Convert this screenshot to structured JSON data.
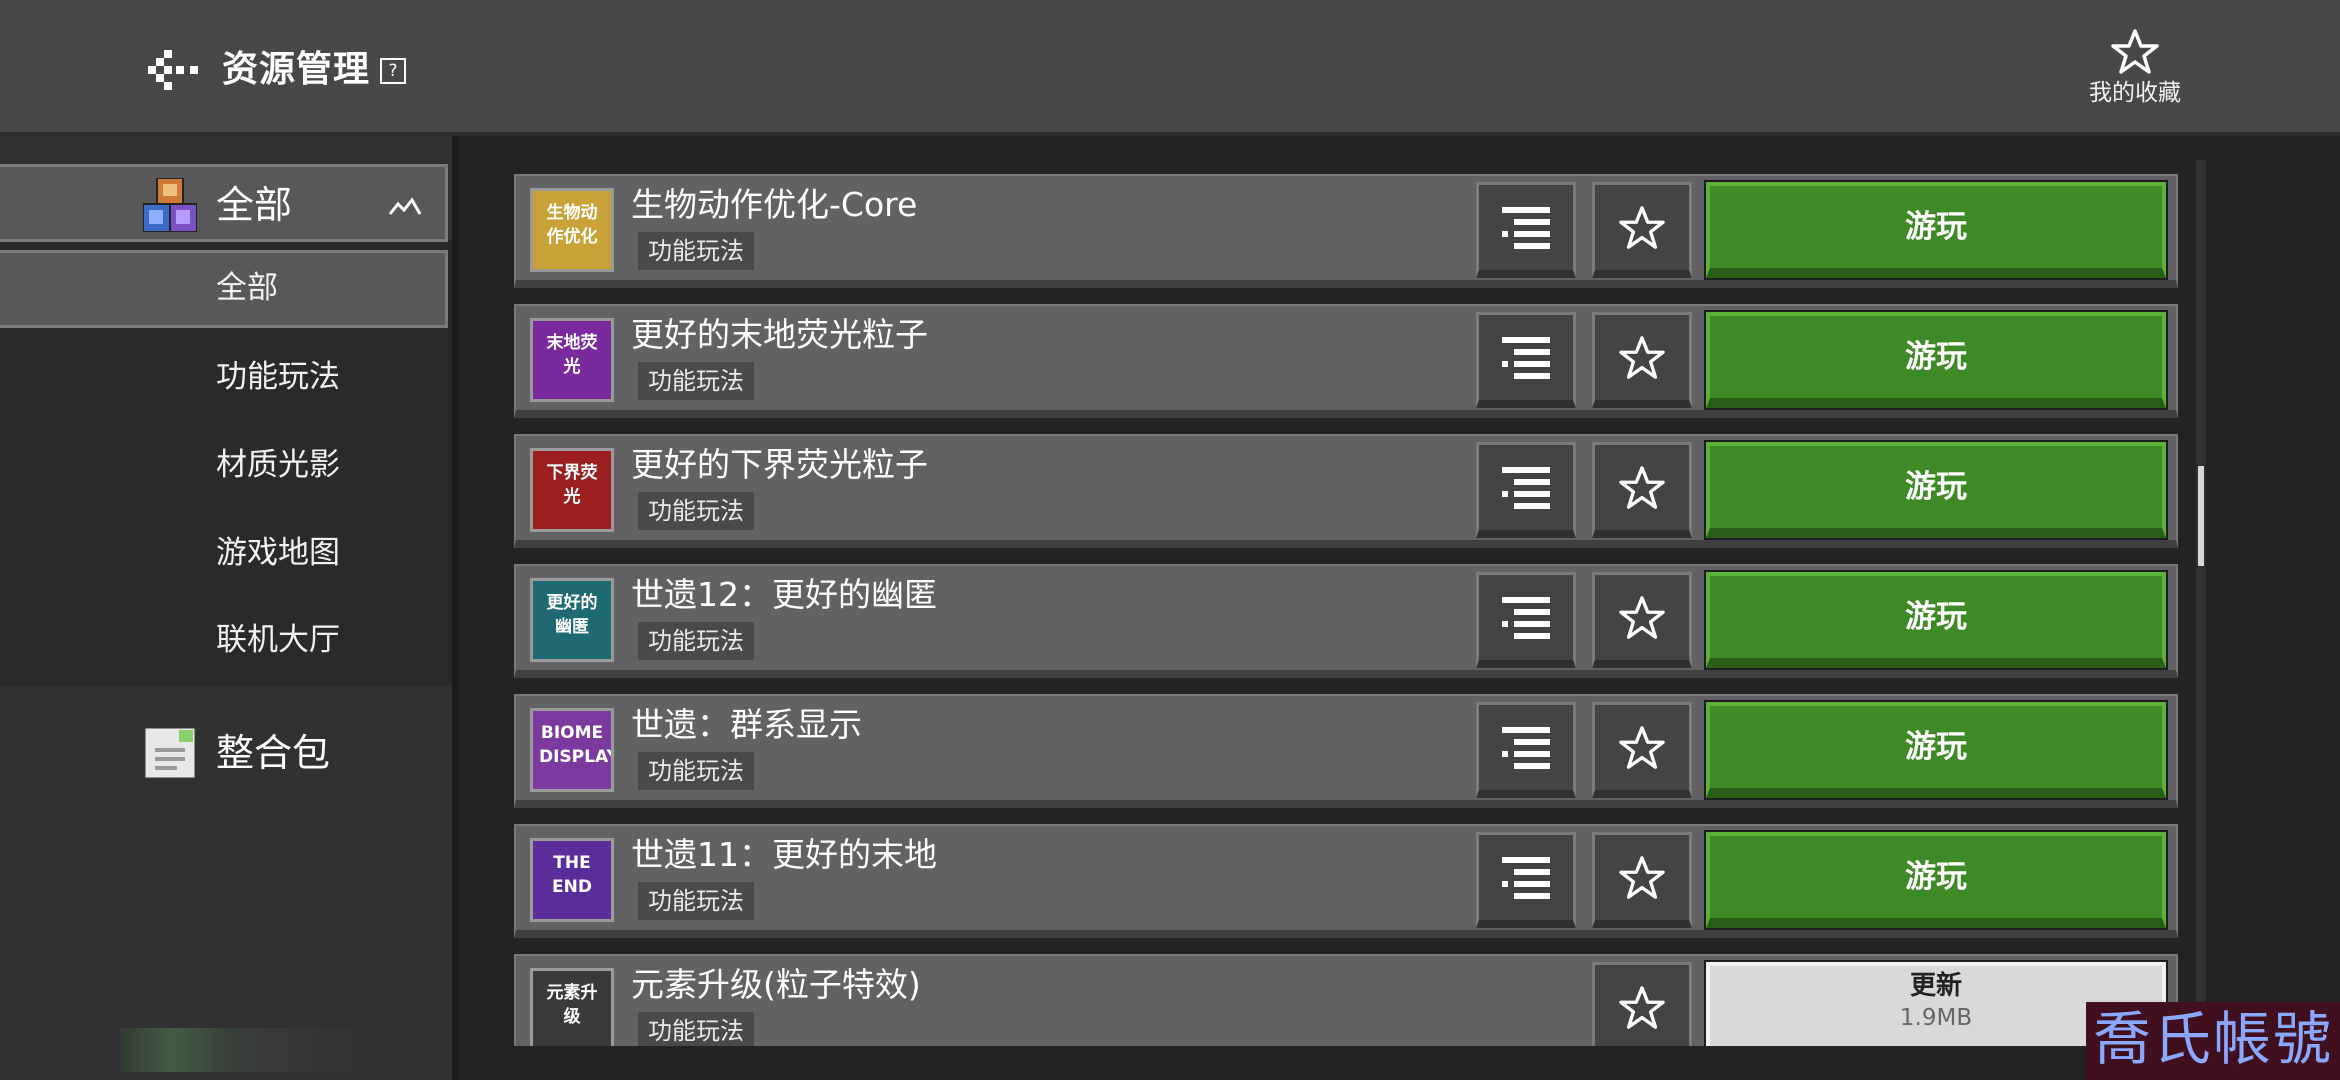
{
  "header": {
    "title": "资源管理",
    "help_icon_glyph": "?",
    "favorites_label": "我的收藏"
  },
  "sidebar": {
    "category_all": "全部",
    "sub_items": [
      "全部",
      "功能玩法",
      "材质光影",
      "游戏地图",
      "联机大厅"
    ],
    "category_pack": "整合包"
  },
  "resources": [
    {
      "name": "生物动作优化-Core",
      "tag": "功能玩法",
      "thumb_text": "生物动作优化",
      "thumb_color": "#c9a23a",
      "action": "游玩"
    },
    {
      "name": "更好的末地荧光粒子",
      "tag": "功能玩法",
      "thumb_text": "末地荧光",
      "thumb_color": "#7b2a9e",
      "action": "游玩"
    },
    {
      "name": "更好的下界荧光粒子",
      "tag": "功能玩法",
      "thumb_text": "下界荧光",
      "thumb_color": "#9b1f1f",
      "action": "游玩"
    },
    {
      "name": "世遗12：更好的幽匿",
      "tag": "功能玩法",
      "thumb_text": "更好的幽匿",
      "thumb_color": "#1e6a70",
      "action": "游玩"
    },
    {
      "name": "世遗：群系显示",
      "tag": "功能玩法",
      "thumb_text": "BIOME DISPLAY",
      "thumb_color": "#7a3a9e",
      "action": "游玩"
    },
    {
      "name": "世遗11：更好的末地",
      "tag": "功能玩法",
      "thumb_text": "THE END",
      "thumb_color": "#5a2e9a",
      "action": "游玩"
    },
    {
      "name": "元素升级(粒子特效)",
      "tag": "功能玩法",
      "thumb_text": "元素升级",
      "thumb_color": "#3a3a3a",
      "action": "更新",
      "size": "1.9MB"
    }
  ],
  "watermark": "喬氏帳號",
  "colors": {
    "play_green": "#3e8a26",
    "header_bg": "#48484a",
    "sidebar_bg": "#313133"
  }
}
